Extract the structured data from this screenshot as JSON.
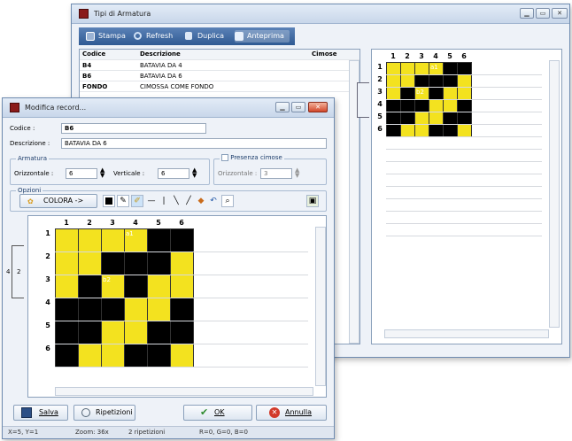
{
  "back_window": {
    "title": "Tipi di Armatura",
    "toolbar": {
      "print": "Stampa",
      "refresh": "Refresh",
      "duplicate": "Duplica",
      "preview": "Anteprima"
    },
    "table": {
      "headers": [
        "Codice",
        "Descrizione",
        "Cimose"
      ],
      "rows": [
        {
          "code": "B4",
          "desc": "BATAVIA DA 4"
        },
        {
          "code": "B6",
          "desc": "BATAVIA DA 6"
        },
        {
          "code": "FONDO",
          "desc": "CIMOSSA COME FONDO"
        }
      ]
    },
    "preview_grid": {
      "col_headers": [
        "1",
        "2",
        "3",
        "4",
        "5",
        "6"
      ],
      "row_headers": [
        "1",
        "2",
        "3",
        "4",
        "5",
        "6"
      ],
      "marker_a": "a1",
      "marker_b": "b2"
    }
  },
  "front_window": {
    "title": "Modifica record...",
    "code_label": "Codice :",
    "code_value": "B6",
    "desc_label": "Descrizione :",
    "desc_value": "BATAVIA DA 6",
    "armatura": {
      "title": "Armatura",
      "horizontal_label": "Orizzontale :",
      "horizontal_value": "6",
      "vertical_label": "Verticale :",
      "vertical_value": "6"
    },
    "cimose": {
      "title": "Presenza cimose",
      "horizontal_label": "Orizzontale :",
      "horizontal_value": "3"
    },
    "options": {
      "title": "Opzioni",
      "color_button": "COLORA ->"
    },
    "grid": {
      "col_headers": [
        "1",
        "2",
        "3",
        "4",
        "5",
        "6"
      ],
      "row_headers": [
        "1",
        "2",
        "3",
        "4",
        "5",
        "6"
      ],
      "marker_a": "a1",
      "marker_b": "b2",
      "bracket_labels": [
        "4",
        "2"
      ]
    },
    "buttons": {
      "save": "Salva",
      "repeats": "Ripetizioni",
      "ok": "OK",
      "cancel": "Annulla"
    },
    "status": {
      "coords": "X=5, Y=1",
      "zoom": "Zoom: 36x",
      "repeats": "2 ripetizioni",
      "rgb": "R=0, G=0, B=0"
    }
  },
  "pattern": [
    [
      "y",
      "y",
      "y",
      "y",
      "k",
      "k"
    ],
    [
      "y",
      "y",
      "k",
      "k",
      "k",
      "y"
    ],
    [
      "y",
      "k",
      "y",
      "k",
      "y",
      "y"
    ],
    [
      "k",
      "k",
      "k",
      "y",
      "y",
      "k"
    ],
    [
      "k",
      "k",
      "y",
      "y",
      "k",
      "k"
    ],
    [
      "k",
      "y",
      "y",
      "k",
      "k",
      "y"
    ]
  ]
}
